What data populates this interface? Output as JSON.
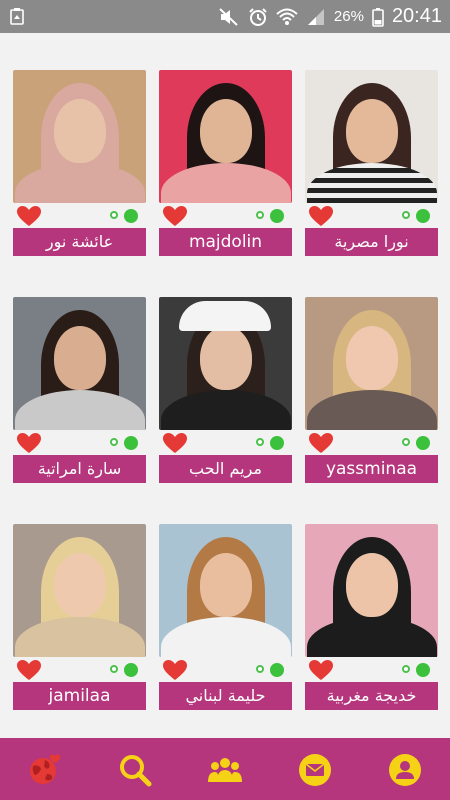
{
  "status_bar": {
    "battery_percent": "26%",
    "time": "20:41"
  },
  "colors": {
    "accent": "#b5367d",
    "heart": "#e53935",
    "online": "#3bc13b",
    "nav_icon": "#f6d216"
  },
  "profiles": [
    {
      "name": "عائشة نور",
      "online": true
    },
    {
      "name": "majdolin",
      "online": true
    },
    {
      "name": "نورا مصرية",
      "online": true
    },
    {
      "name": "سارة امراتية",
      "online": true
    },
    {
      "name": "مريم الحب",
      "online": true
    },
    {
      "name": "yassminaa",
      "online": true
    },
    {
      "name": "jamilaa",
      "online": true
    },
    {
      "name": "حليمة لبناني",
      "online": true
    },
    {
      "name": "خديجة مغربية",
      "online": true
    }
  ],
  "bottom_nav": [
    {
      "icon": "globe-heart-icon",
      "active": true
    },
    {
      "icon": "search-icon",
      "active": false
    },
    {
      "icon": "group-icon",
      "active": false
    },
    {
      "icon": "mail-icon",
      "active": false
    },
    {
      "icon": "profile-icon",
      "active": false
    }
  ]
}
